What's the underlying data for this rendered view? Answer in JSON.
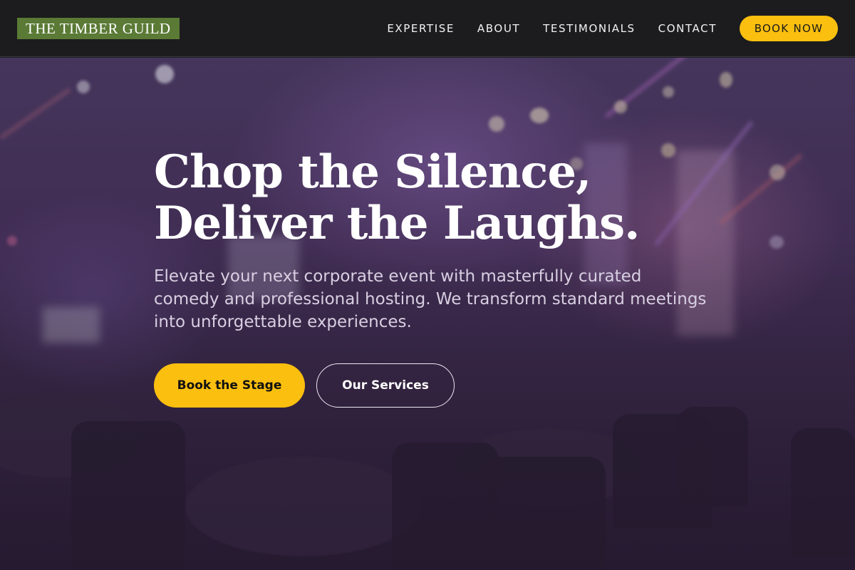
{
  "header": {
    "logo": "THE TIMBER GUILD",
    "nav": [
      "EXPERTISE",
      "ABOUT",
      "TESTIMONIALS",
      "CONTACT"
    ],
    "cta": "BOOK NOW"
  },
  "hero": {
    "headline_line1": "Chop the Silence,",
    "headline_line2": "Deliver the Laughs.",
    "subtext": "Elevate your next corporate event with masterfully curated comedy and professional hosting. We transform standard meetings into unforgettable experiences.",
    "primary_button": "Book the Stage",
    "secondary_button": "Our Services"
  },
  "colors": {
    "accent": "#fbbf0f",
    "logo_bg": "#5a7a35",
    "header_bg": "#1c1c1e",
    "hero_tint": "#4a3a62"
  }
}
